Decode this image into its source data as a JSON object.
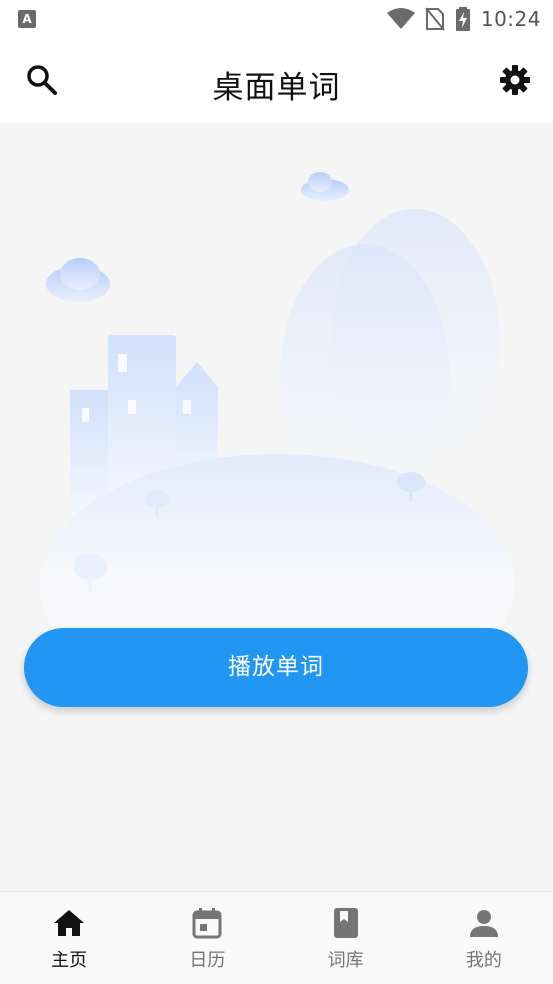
{
  "status_bar": {
    "time": "10:24",
    "left_icon": "A",
    "icons": [
      "wifi-icon",
      "no-sim-icon",
      "battery-charging-icon"
    ]
  },
  "app_bar": {
    "title": "桌面单词",
    "left_icon": "search-icon",
    "right_icon": "settings-icon"
  },
  "main": {
    "play_button_label": "播放单词"
  },
  "bottom_nav": {
    "items": [
      {
        "label": "主页",
        "icon": "home-icon",
        "active": true
      },
      {
        "label": "日历",
        "icon": "calendar-icon",
        "active": false
      },
      {
        "label": "词库",
        "icon": "book-icon",
        "active": false
      },
      {
        "label": "我的",
        "icon": "person-icon",
        "active": false
      }
    ]
  },
  "colors": {
    "accent": "#2196f3",
    "background": "#f5f5f5",
    "bar": "#ffffff",
    "nav_inactive": "#757575",
    "nav_active": "#111111"
  }
}
